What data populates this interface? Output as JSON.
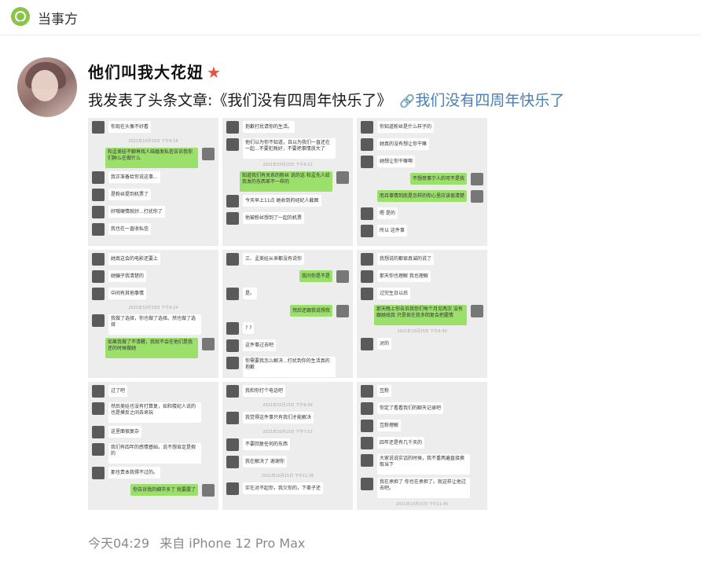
{
  "header": {
    "title": "当事方",
    "logo_icon": "location-pin-logo-icon"
  },
  "post": {
    "username": "他们叫我大花妞",
    "badge_icon": "red-star-icon",
    "text": "我发表了头条文章:《我们没有四周年快乐了》",
    "link_icon": "chain-link-icon",
    "link_text": "我们没有四周年快乐了",
    "time": "今天04:29",
    "source": "来自 iPhone 12 Pro Max"
  },
  "chat_grid": [
    {
      "messages": [
        {
          "side": "l",
          "text": "你现在头像不好看"
        },
        {
          "side": "t",
          "text": "2021年10月15日 下午6:16"
        },
        {
          "side": "r",
          "text": "和孟美娃不聊再找人结婚发私信告诉我你们肿么在做什么"
        },
        {
          "side": "l",
          "text": "我正准备给你说这事..."
        },
        {
          "side": "l",
          "text": "是粉丝提到机票了"
        },
        {
          "side": "l",
          "text": "好哦硬情就好...打扰你了"
        },
        {
          "side": "l",
          "text": "我也在一直收私信"
        }
      ]
    },
    {
      "messages": [
        {
          "side": "l",
          "text": "抱歉打扰请你的生活。"
        },
        {
          "side": "l",
          "text": "他们以为你不知道，且以为我们一直还在一起...不要犯贱好，不要把事情放大了"
        },
        {
          "side": "t",
          "text": "2021年10月15日 下午6:21"
        },
        {
          "side": "r",
          "text": "知道我们有关系的粉丝 说的话 和孟先人给我发的东西差不一样的"
        },
        {
          "side": "l",
          "text": "今天早上11点 她收到的经纪人截图"
        },
        {
          "side": "l",
          "text": "他被粉丝想到了一起的机票"
        }
      ]
    },
    {
      "messages": [
        {
          "side": "l",
          "text": "你知道粉丝是什么样子的"
        },
        {
          "side": "l",
          "text": "她真的没有想让你干嘛"
        },
        {
          "side": "l",
          "text": "她想让你干嘛啊"
        },
        {
          "side": "r",
          "text": "不想意事宁人的可不是我"
        },
        {
          "side": "r",
          "text": "而且事情到底是怎样的你心里应该很清楚"
        },
        {
          "side": "l",
          "text": "嗯 是的"
        },
        {
          "side": "l",
          "text": "所以 这件事"
        }
      ]
    },
    {
      "messages": [
        {
          "side": "l",
          "text": "她真这会的电影还要上"
        },
        {
          "side": "l",
          "text": "她骗子我清楚的"
        },
        {
          "side": "l",
          "text": "中间有其他事情"
        },
        {
          "side": "t",
          "text": "2021年10月15日 下午6:24"
        },
        {
          "side": "l",
          "text": "我做了选择，你也做了选择。然也做了选择"
        },
        {
          "side": "r",
          "text": "如果我做了不清醒，我就不会在他们是我还的时候做她"
        }
      ]
    },
    {
      "messages": [
        {
          "side": "l",
          "text": "三、孟美娃从来都没有说你"
        },
        {
          "side": "r",
          "text": "我问你是不是"
        },
        {
          "side": "l",
          "text": "是。"
        },
        {
          "side": "r",
          "text": "然后还跟我说想我"
        },
        {
          "side": "l",
          "text": "? ?"
        },
        {
          "side": "l",
          "text": "这件事过去吧"
        },
        {
          "side": "l",
          "text": "你需要我怎么解决...打扰到你的生活真的抱歉"
        }
      ]
    },
    {
      "messages": [
        {
          "side": "l",
          "text": "我想说的都很真诚的说了"
        },
        {
          "side": "l",
          "text": "那天你也理解 我也理解"
        },
        {
          "side": "l",
          "text": "过完生日以后"
        },
        {
          "side": "r",
          "text": "那天晚上你告诉我你们每个月见两次 没有跟她找我 只是现在我多回复会把握情"
        },
        {
          "side": "t",
          "text": "2021年10月15日 下午6:30"
        },
        {
          "side": "l",
          "text": "对的"
        }
      ]
    },
    {
      "messages": [
        {
          "side": "l",
          "text": "过了吧"
        },
        {
          "side": "l",
          "text": "然后美娃也没有打算复，如和楼纪人说的也是摸反之间去来玩"
        },
        {
          "side": "l",
          "text": "这里面很复杂"
        },
        {
          "side": "l",
          "text": "我们有四年的感情基础，说不想肯定是假的"
        },
        {
          "side": "l",
          "text": "那也贵本我得不过的。"
        },
        {
          "side": "r",
          "text": "你告诉我的细节多了 就要露了"
        }
      ]
    },
    {
      "messages": [
        {
          "side": "l",
          "text": "我和你打个电话吧"
        },
        {
          "side": "t",
          "text": "2021年10月15日 下午6:49"
        },
        {
          "side": "l",
          "text": "我觉得这件事只有我们才能解决"
        },
        {
          "side": "t",
          "text": "2021年10月15日 下午7:53"
        },
        {
          "side": "l",
          "text": "不要回复任何的东西"
        },
        {
          "side": "l",
          "text": "我在解决了 谢谢你"
        },
        {
          "side": "t",
          "text": "2021年10月15日 下午11:36"
        },
        {
          "side": "l",
          "text": "实在对不起你，我欠你的，下辈子还"
        }
      ]
    },
    {
      "messages": [
        {
          "side": "l",
          "text": "互粉"
        },
        {
          "side": "l",
          "text": "你定了看看我们的聊天记录吧"
        },
        {
          "side": "l",
          "text": "互粉理解"
        },
        {
          "side": "l",
          "text": "四年还是有几千天的"
        },
        {
          "side": "l",
          "text": "大家说说实话的时候，我不重两遍直接换取当下"
        },
        {
          "side": "l",
          "text": "我在承担了 你也在承担了。就这样让他过去吧。"
        },
        {
          "side": "t",
          "text": "2021年10月15日 下午11:40"
        }
      ]
    }
  ]
}
